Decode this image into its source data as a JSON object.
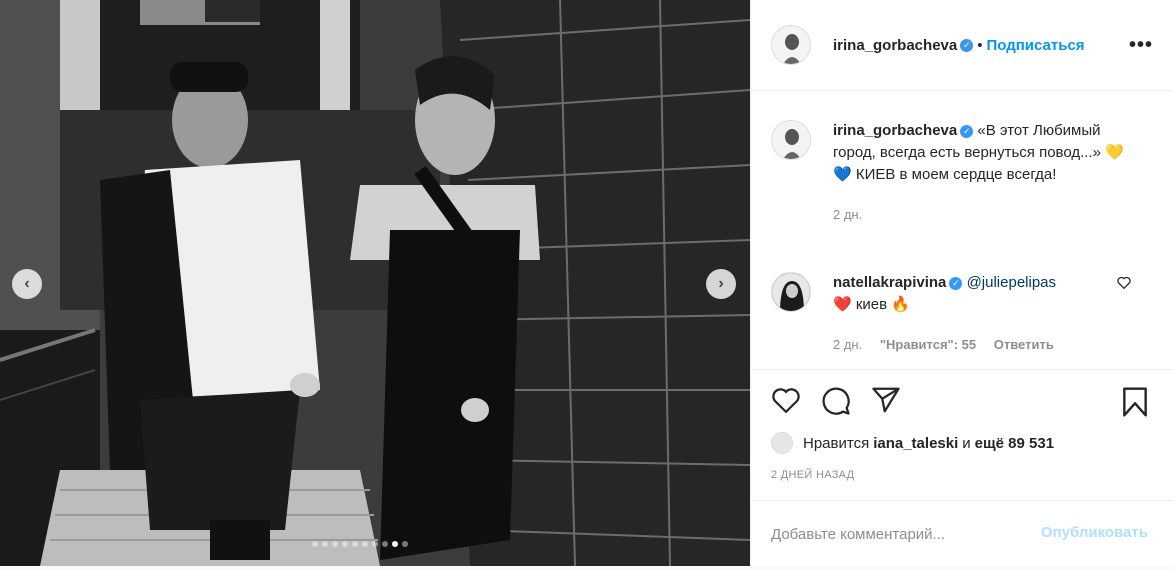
{
  "carousel": {
    "prev_glyph": "‹",
    "next_glyph": "›",
    "dot_count": 10,
    "active_dot": 8
  },
  "header": {
    "username": "irina_gorbacheva",
    "bullet": "•",
    "follow_label": "Подписаться",
    "more_label": "•••"
  },
  "caption": {
    "username": "irina_gorbacheva",
    "text": "«В этот Любимый город, всегда есть вернуться повод...» 💛💙 КИЕВ в моем сердце всегда!",
    "time": "2 дн."
  },
  "comment": {
    "username": "natellakrapivina",
    "mention": "@juliepelipas",
    "text": "❤️ киев 🔥",
    "time": "2 дн.",
    "likes_label": "\"Нравится\": 55",
    "reply_label": "Ответить"
  },
  "likes": {
    "prefix": "Нравится",
    "user": "iana_taleski",
    "connector": "и",
    "others": "ещё 89 531"
  },
  "posted": "2 ДНЕЙ НАЗАД",
  "composer": {
    "placeholder": "Добавьте комментарий...",
    "publish_label": "Опубликовать"
  },
  "icons": {
    "verified": "verified-badge-icon",
    "like": "heart-icon",
    "comment": "comment-icon",
    "share": "paper-plane-icon",
    "save": "bookmark-icon"
  },
  "colors": {
    "link": "#0095f6",
    "verified": "#3897f0",
    "publish_disabled": "#b2dffc",
    "muted": "#8e8e8e"
  }
}
